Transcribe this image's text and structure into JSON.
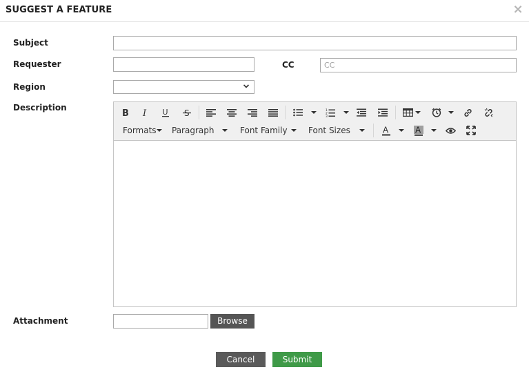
{
  "dialog": {
    "title": "SUGGEST A FEATURE",
    "close_glyph": "×"
  },
  "form": {
    "subject": {
      "label": "Subject",
      "value": "",
      "placeholder": ""
    },
    "requester": {
      "label": "Requester",
      "value": "",
      "placeholder": ""
    },
    "cc": {
      "label": "CC",
      "value": "",
      "placeholder": "CC"
    },
    "region": {
      "label": "Region",
      "selected": ""
    },
    "description": {
      "label": "Description",
      "content": ""
    },
    "attachment": {
      "label": "Attachment",
      "browse_label": "Browse"
    }
  },
  "toolbar": {
    "row1_icons": [
      "bold-icon",
      "italic-icon",
      "underline-icon",
      "strikethrough-icon",
      "align-left-icon",
      "align-center-icon",
      "align-right-icon",
      "align-justify-icon",
      "bullet-list-icon",
      "numbered-list-icon",
      "outdent-icon",
      "indent-icon",
      "table-icon",
      "clock-icon",
      "link-icon",
      "unlink-icon"
    ],
    "formats_label": "Formats",
    "paragraph_label": "Paragraph",
    "font_family_label": "Font Family",
    "font_sizes_label": "Font Sizes",
    "row2_icons": [
      "text-color-icon",
      "background-color-icon",
      "preview-eye-icon",
      "fullscreen-icon"
    ]
  },
  "actions": {
    "cancel_label": "Cancel",
    "submit_label": "Submit"
  },
  "colors": {
    "submit": "#3f9a48",
    "cancel": "#5a5a5a",
    "browse": "#555555",
    "toolbar_bg": "#f0f0f0"
  }
}
